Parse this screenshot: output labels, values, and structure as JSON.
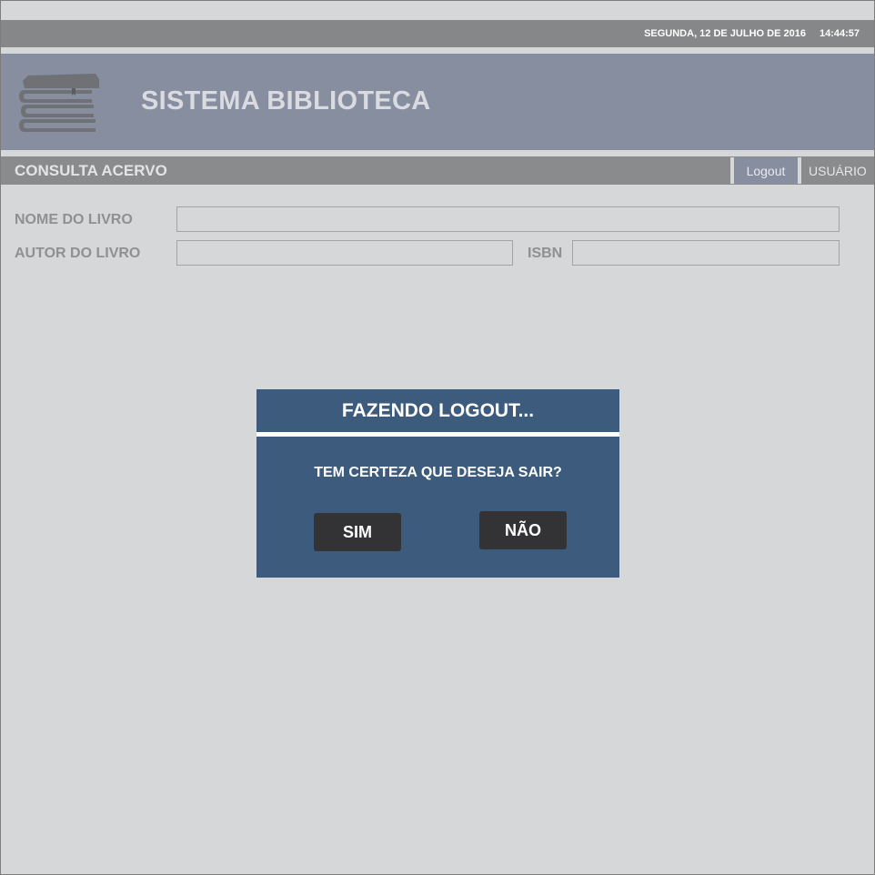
{
  "topbar": {
    "date": "SEGUNDA, 12 DE JULHO DE 2016",
    "time": "14:44:57"
  },
  "header": {
    "logo_icon": "books-stack-icon",
    "title": "SISTEMA BIBLIOTECA"
  },
  "nav": {
    "section_title": "CONSULTA ACERVO",
    "logout_label": "Logout",
    "user_label": "USUÁRIO"
  },
  "search": {
    "book_name_label": "NOME DO LIVRO",
    "book_name_value": "",
    "author_label": "AUTOR DO LIVRO",
    "author_value": "",
    "isbn_label": "ISBN",
    "isbn_value": ""
  },
  "dialog": {
    "title": "FAZENDO LOGOUT...",
    "message": "TEM CERTEZA QUE DESEJA SAIR?",
    "yes_label": "SIM",
    "no_label": "NÃO"
  },
  "colors": {
    "background": "#d6d7d9",
    "topbar": "#868788",
    "header": "#878ea0",
    "dialog": "#3d5b7d",
    "dialog_button": "#333234"
  }
}
